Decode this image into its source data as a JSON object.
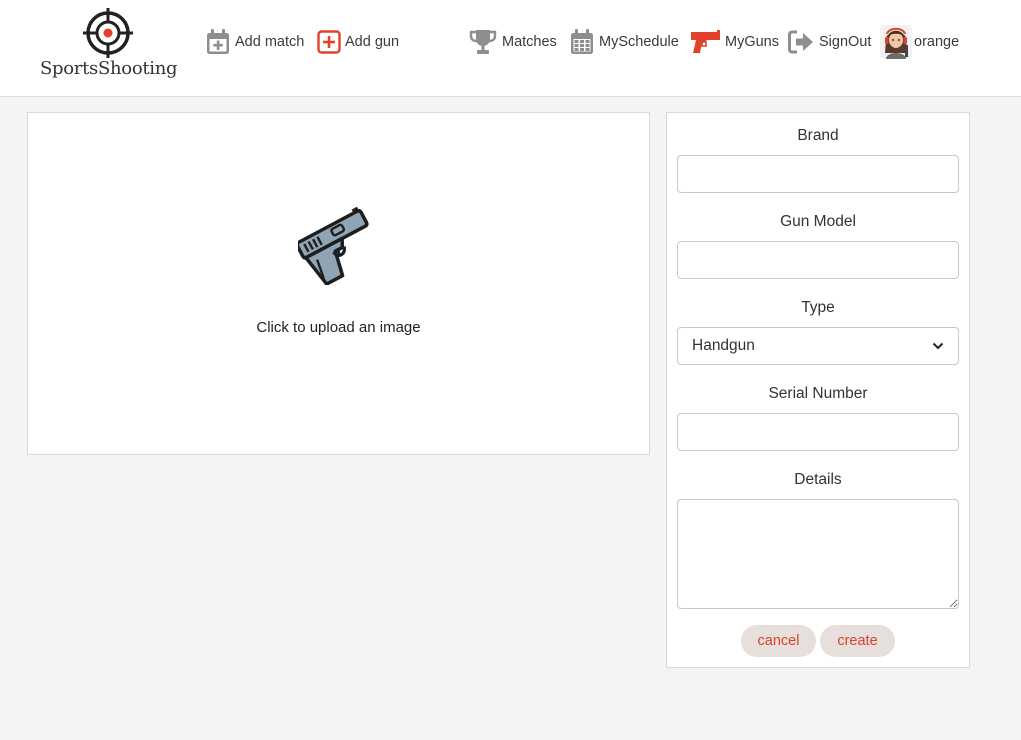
{
  "header": {
    "logo_text": "SportsShooting",
    "nav": {
      "add_match": "Add match",
      "add_gun": "Add gun",
      "matches": "Matches",
      "my_schedule": "MySchedule",
      "my_guns": "MyGuns",
      "sign_out": "SignOut",
      "username": "orange"
    },
    "icons": {
      "logo": "crosshair-icon",
      "add_match": "calendar-plus-icon",
      "add_gun": "plus-square-icon",
      "matches": "trophy-icon",
      "my_schedule": "calendar-icon",
      "my_guns": "gun-icon",
      "sign_out": "sign-out-icon",
      "profile": "avatar"
    }
  },
  "upload": {
    "text": "Click to upload an image",
    "icon": "pistol-icon"
  },
  "form": {
    "brand_label": "Brand",
    "brand_value": "",
    "model_label": "Gun Model",
    "model_value": "",
    "type_label": "Type",
    "type_value": "Handgun",
    "serial_label": "Serial Number",
    "serial_value": "",
    "details_label": "Details",
    "details_value": "",
    "cancel_label": "cancel",
    "create_label": "create"
  },
  "colors": {
    "accent": "#e2412a",
    "nav_icon_gray": "#8e8e8e",
    "button_bg": "#e6dfdc",
    "page_bg": "#f4f4f4"
  }
}
